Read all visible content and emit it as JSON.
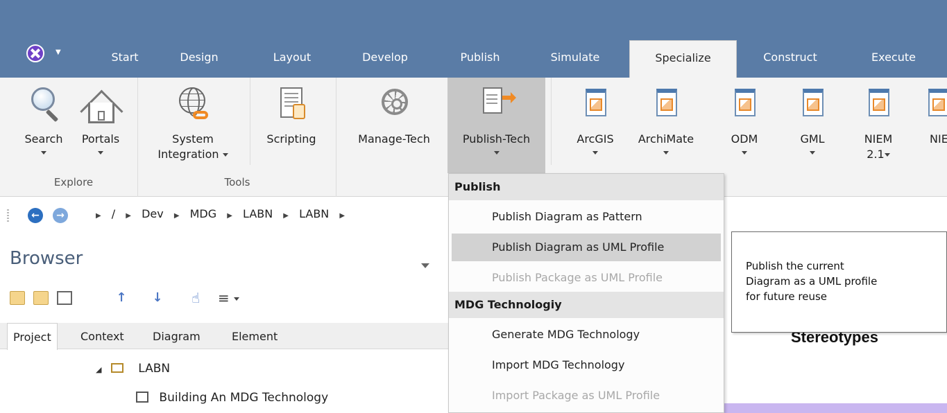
{
  "tabs": [
    "Start",
    "Design",
    "Layout",
    "Develop",
    "Publish",
    "Simulate",
    "Specialize",
    "Construct",
    "Execute"
  ],
  "active_tab": "Specialize",
  "ribbon": {
    "buttons": [
      {
        "label": "Search",
        "icon": "search-icon"
      },
      {
        "label": "Portals",
        "icon": "house-icon"
      },
      {
        "label": "System",
        "label2": "Integration",
        "icon": "globe-link-icon"
      },
      {
        "label": "Scripting",
        "icon": "script-icon"
      },
      {
        "label": "Manage-Tech",
        "icon": "wheel-icon"
      },
      {
        "label": "Publish-Tech",
        "icon": "publish-document-icon"
      },
      {
        "label": "ArcGIS",
        "icon": "mdg-icon"
      },
      {
        "label": "ArchiMate",
        "icon": "mdg-icon"
      },
      {
        "label": "ODM",
        "icon": "mdg-icon"
      },
      {
        "label": "GML",
        "icon": "mdg-icon"
      },
      {
        "label": "NIEM",
        "label2": "2.1",
        "icon": "mdg-icon"
      },
      {
        "label": "NIE",
        "icon": "mdg-icon"
      }
    ],
    "groups": [
      "Explore",
      "Tools"
    ]
  },
  "breadcrumb": [
    "/",
    "Dev",
    "MDG",
    "LABN",
    "LABN"
  ],
  "browser": {
    "title": "Browser",
    "tabs": [
      "Project",
      "Context",
      "Diagram",
      "Element"
    ],
    "tree": [
      {
        "label": "LABN",
        "icon": "folder-icon"
      },
      {
        "label": "Building An MDG Technology",
        "icon": "diagram-icon"
      }
    ]
  },
  "menu": {
    "sections": [
      {
        "header": "Publish",
        "items": [
          {
            "label": "Publish Diagram as Pattern",
            "state": "normal"
          },
          {
            "label": "Publish Diagram as UML Profile",
            "state": "hover"
          },
          {
            "label": "Publish Package as UML Profile",
            "state": "disabled"
          }
        ]
      },
      {
        "header": "MDG Technologiy",
        "items": [
          {
            "label": "Generate MDG Technology",
            "state": "normal"
          },
          {
            "label": "Import MDG Technology",
            "state": "normal"
          },
          {
            "label": "Import Package as UML Profile",
            "state": "disabled"
          }
        ]
      }
    ]
  },
  "tooltip": {
    "lines": [
      "Publish the current",
      "Diagram as a UML profile",
      "for future reuse"
    ]
  },
  "diagram": {
    "heading": "Stereotypes"
  },
  "colors": {
    "titlebar": "#5a7ca6",
    "ribbon": "#f3f3f3",
    "accent_orange": "#f08a24",
    "menu_hover": "#d2d2d2",
    "diagram_band": "#c9b6f0"
  }
}
